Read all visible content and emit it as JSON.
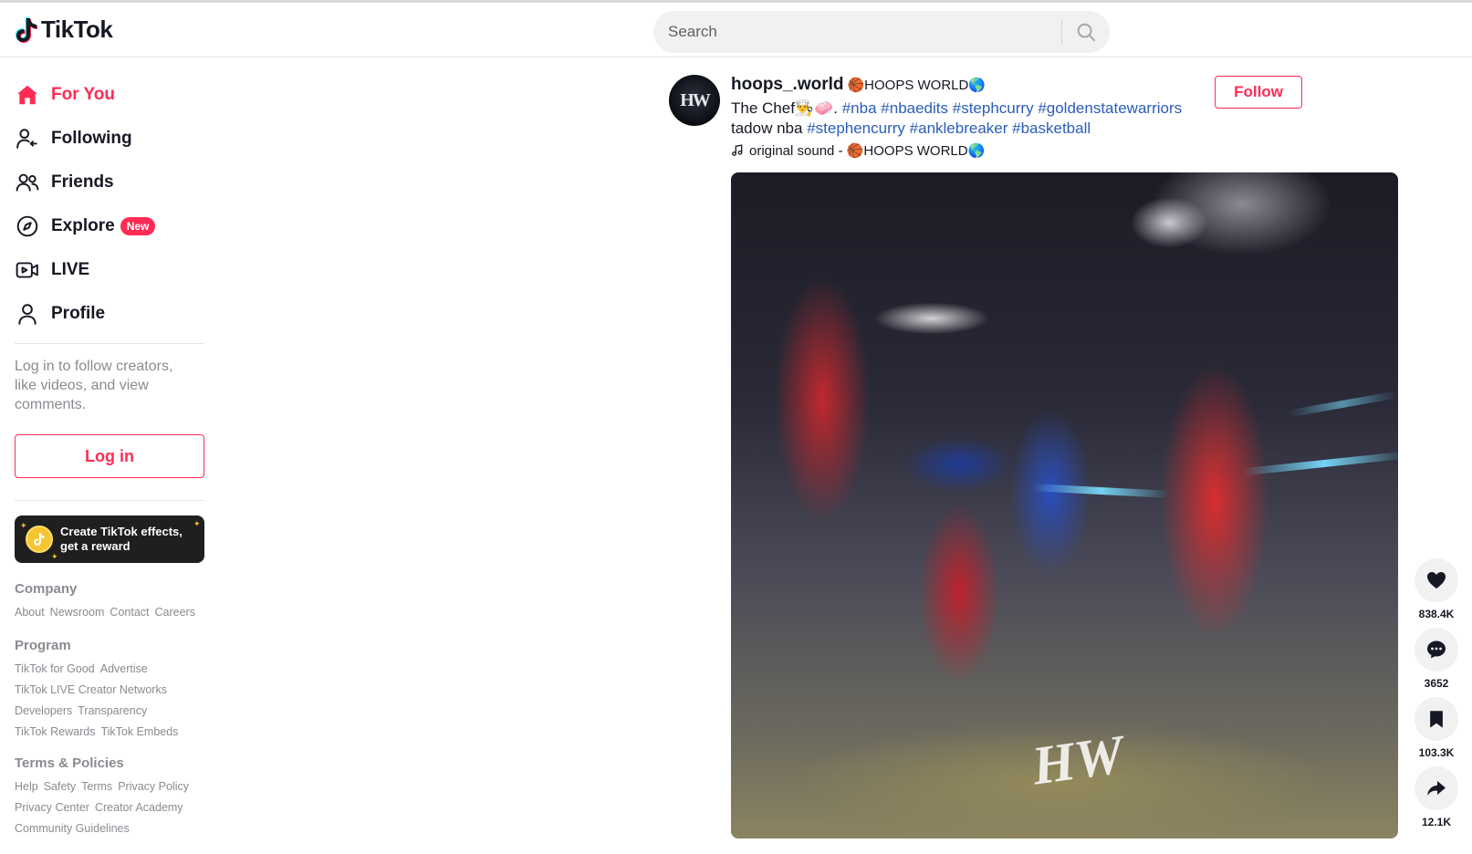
{
  "app": {
    "name": "TikTok",
    "brand_color": "#fe2c55"
  },
  "search": {
    "placeholder": "Search"
  },
  "sidebar": {
    "nav": [
      {
        "label": "For You",
        "icon": "home-icon",
        "active": true
      },
      {
        "label": "Following",
        "icon": "following-icon"
      },
      {
        "label": "Friends",
        "icon": "friends-icon"
      },
      {
        "label": "Explore",
        "icon": "compass-icon",
        "badge": "New"
      },
      {
        "label": "LIVE",
        "icon": "live-icon"
      },
      {
        "label": "Profile",
        "icon": "profile-icon"
      }
    ],
    "login_hint": "Log in to follow creators, like videos, and view comments.",
    "login_label": "Log in",
    "effects_banner": {
      "line1": "Create TikTok effects,",
      "line2": "get a reward"
    },
    "footer": [
      {
        "title": "Company",
        "links": [
          "About",
          "Newsroom",
          "Contact",
          "Careers"
        ]
      },
      {
        "title": "Program",
        "links": [
          "TikTok for Good",
          "Advertise",
          "TikTok LIVE Creator Networks",
          "Developers",
          "Transparency",
          "TikTok Rewards",
          "TikTok Embeds"
        ]
      },
      {
        "title": "Terms & Policies",
        "links": [
          "Help",
          "Safety",
          "Terms",
          "Privacy Policy",
          "Privacy Center",
          "Creator Academy",
          "Community Guidelines"
        ]
      }
    ]
  },
  "post": {
    "avatar_text": "HW",
    "author_id": "hoops_.world",
    "author_nick": "🏀HOOPS WORLD🌎",
    "caption_prefix": "The Chef👨‍🍳🧼.",
    "caption_tags_1": [
      "#nba",
      "#nbaedits",
      "#stephcurry",
      "#goldenstatewarriors"
    ],
    "caption_mid": "tadow nba",
    "caption_tags_2": [
      "#stephencurry",
      "#anklebreaker",
      "#basketball"
    ],
    "music": "original sound - 🏀HOOPS WORLD🌎",
    "follow_label": "Follow",
    "video_watermark": "HW",
    "actions": {
      "likes": "838.4K",
      "comments": "3652",
      "saves": "103.3K",
      "shares": "12.1K"
    }
  }
}
